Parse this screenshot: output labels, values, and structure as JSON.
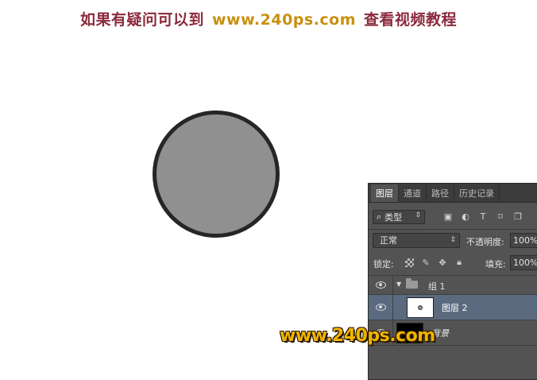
{
  "banner": {
    "part1": "如果有疑问可以到",
    "part2": "www.240ps.com",
    "part3": "查看视频教程"
  },
  "canvas": {
    "shape": "circle",
    "fill_color": "#909090",
    "stroke_color": "#262626"
  },
  "layers_panel": {
    "tabs": [
      "图层",
      "通道",
      "路径",
      "历史记录"
    ],
    "active_tab": 0,
    "filter": {
      "label": "类型",
      "icons": [
        "image-filter-icon",
        "adjustment-filter-icon",
        "type-filter-icon",
        "shape-filter-icon",
        "smart-object-filter-icon"
      ]
    },
    "blend_mode": "正常",
    "opacity_label": "不透明度:",
    "opacity_value": "100%",
    "lock_label": "锁定:",
    "lock_icons": [
      "lock-transparent-icon",
      "lock-image-icon",
      "lock-position-icon",
      "lock-all-icon"
    ],
    "fill_label": "填充:",
    "fill_value": "100%",
    "layers": [
      {
        "name": "组 1",
        "type": "group",
        "visible": true,
        "expanded": true
      },
      {
        "name": "图层 2",
        "type": "layer",
        "visible": true,
        "selected": true
      },
      {
        "name": "背景",
        "type": "background",
        "visible": true
      }
    ]
  },
  "watermark": "www.240ps.com",
  "colors": {
    "panel_bg": "#535353",
    "selected_row": "#5b6a7f",
    "watermark": "#f0b400"
  }
}
